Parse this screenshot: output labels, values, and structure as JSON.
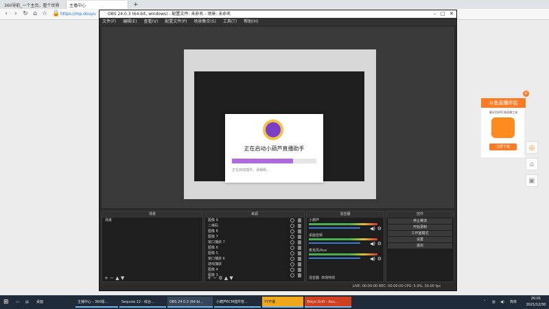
{
  "browser": {
    "tabs": [
      {
        "label": "360导航_一个主页，整个世界"
      },
      {
        "label": "主播中心"
      }
    ],
    "new_tab": "+",
    "address": "https://mp.douyu"
  },
  "obs": {
    "title": "OBS 24.0.3 (64-bit, windows) - 配置文件: 未命名 - 场景: 未命名",
    "menu": [
      "文件(F)",
      "编辑(E)",
      "查看(V)",
      "配置文件(P)",
      "场景集合(S)",
      "工具(T)",
      "帮助(H)"
    ],
    "dialog": {
      "title": "正在启动小葫芦直播助手",
      "progress_pct": 72,
      "status": "正在启动插件，请稍候..."
    },
    "docks": {
      "scenes": {
        "header": "场景",
        "items": [
          "场景"
        ]
      },
      "sources": {
        "header": "来源",
        "items": [
          "图像 9",
          "二维码",
          "图像 8",
          "图像 7",
          "窗口捕获 7",
          "图像 6",
          "图像 5",
          "窗口捕获 6",
          "游戏捕获",
          "图像 4",
          "图像 3"
        ]
      },
      "mixer": {
        "header": "混音器",
        "channels": [
          "小葫芦",
          "桌面音频",
          "麦克风/Aux"
        ]
      },
      "controls": {
        "header": "控件",
        "buttons": [
          "停止推流",
          "开始录制",
          "工作室模式",
          "设置",
          "退出"
        ]
      }
    },
    "mixer_tabs": [
      "混音器",
      "转场特效"
    ],
    "status": "LIVE: 00:00:00   REC: 00:00:00   CPU: 5.9%, 30.00 fps"
  },
  "douyu": {
    "title": "斗鱼直播伴侣",
    "subtitle": "最好用的PC端直播工具",
    "button": "立即下载"
  },
  "taskbar": {
    "items": [
      "主播中心 - 360极...",
      "Sequoia 12 - 综合...",
      "OBS 24.0.3 (64-bi...",
      "小葫芦ECM插件管...",
      "YY开播",
      "Tokyo Drift - Asu..."
    ],
    "desktop_label": "桌面",
    "ime": "简体",
    "time": "20:01",
    "date": "2021/12/30"
  },
  "colors": {
    "accent": "#ff7b22",
    "obs_bg": "#2b2b2b",
    "progress": "#b06ae0"
  }
}
